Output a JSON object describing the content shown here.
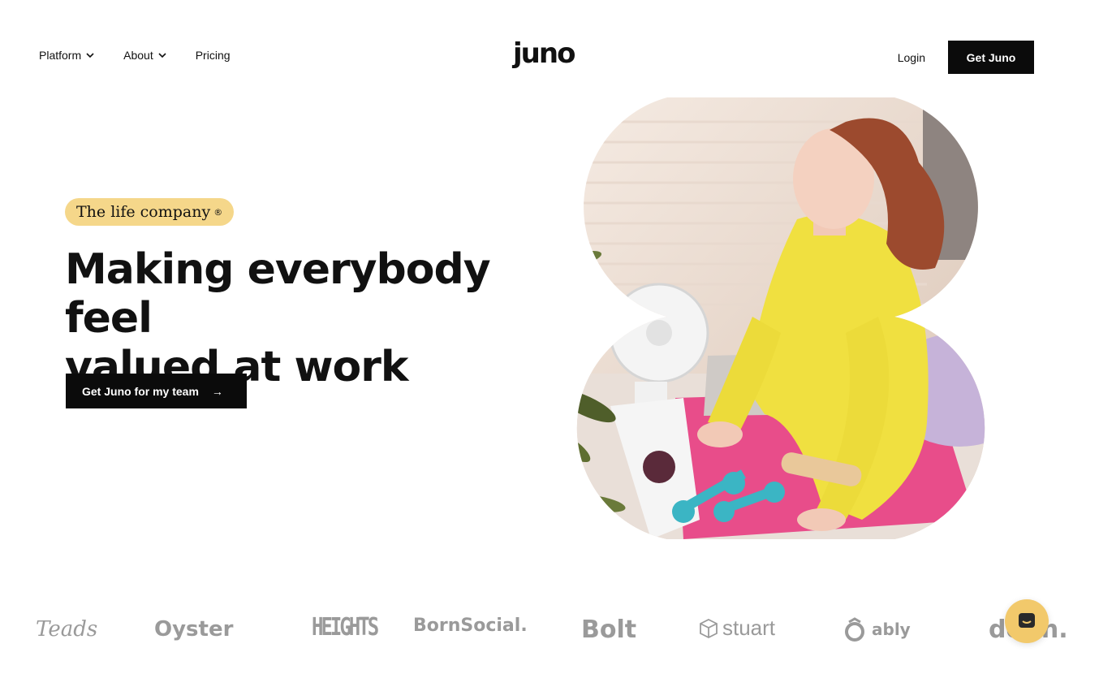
{
  "nav": {
    "platform": "Platform",
    "about": "About",
    "pricing": "Pricing",
    "logo": "juno",
    "login": "Login",
    "cta": "Get Juno"
  },
  "hero": {
    "badge": "The life company",
    "badge_mark": "®",
    "headline_line1": "Making everybody feel",
    "headline_line2": "valued at work",
    "cta": "Get Juno for my team",
    "cta_arrow": "→"
  },
  "brands": {
    "teads": "Teads",
    "oyster": "Oyster",
    "heights": "HEIGHTS",
    "bornsocial": "BornSocial.",
    "bolt": "Bolt",
    "stuart": "stuart",
    "ably": "ably",
    "dots": "do..n."
  },
  "colors": {
    "accent_yellow": "#f5d78a",
    "button_black": "#0b0b0b",
    "brand_gray": "#9a9a9a",
    "shirt_yellow": "#f0e040",
    "mat_pink": "#e84d8a",
    "dumbbell_teal": "#3bb5c4"
  },
  "icons": {
    "chevron": "chevron-down-icon",
    "arrow": "arrow-right-icon",
    "chat": "chat-icon",
    "stuart": "cube-icon",
    "ably": "ably-mark-icon"
  }
}
